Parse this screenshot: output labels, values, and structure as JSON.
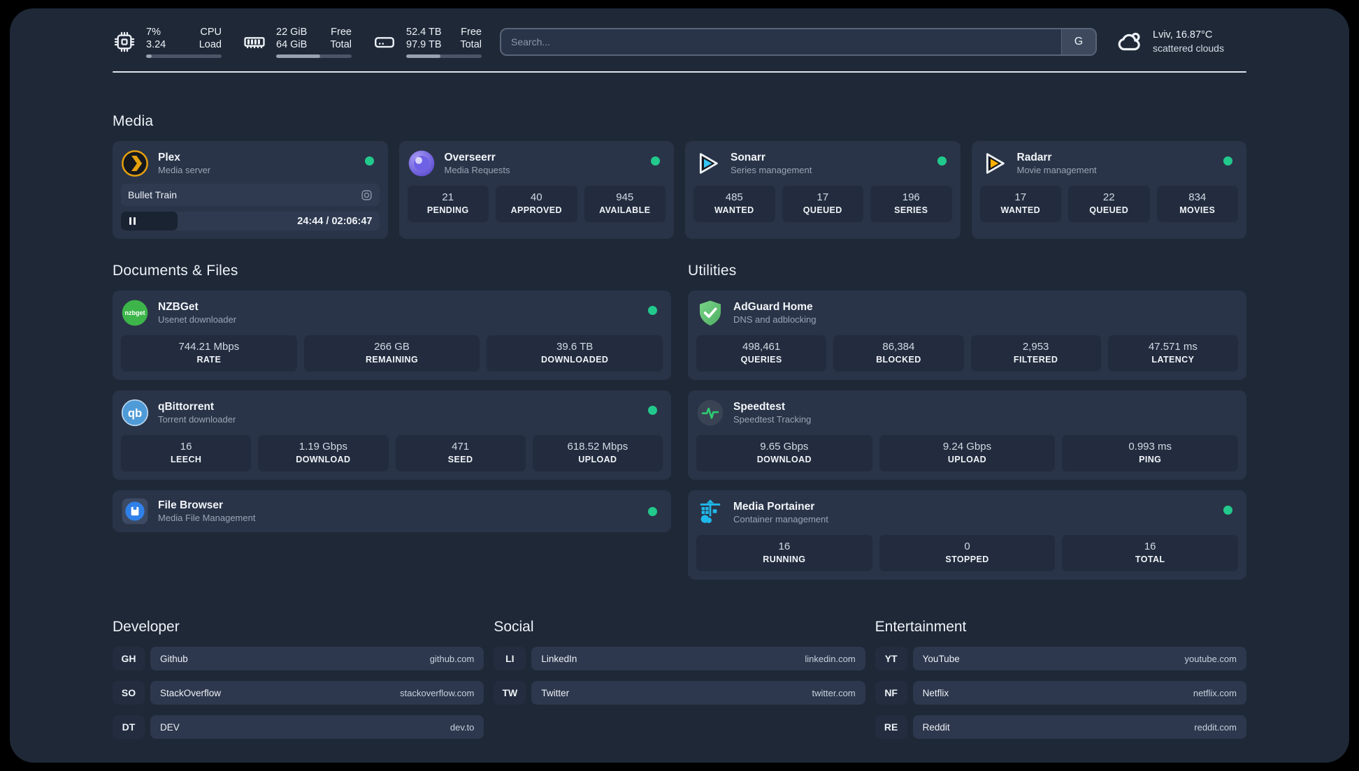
{
  "colors": {
    "status_online": "#22c98c",
    "page_bg": "#1e2837",
    "card_bg": "#2a3448",
    "plex_accent": "#e5a00d",
    "sonarr_accent": "#35c5f4",
    "radarr_accent": "#ffb000",
    "progress_fill": "#97a2b3"
  },
  "header": {
    "metrics": [
      {
        "name": "cpu",
        "values": [
          "7%",
          "3.24"
        ],
        "labels": [
          "CPU",
          "Load"
        ],
        "progress_pct": 7
      },
      {
        "name": "memory",
        "values": [
          "22 GiB",
          "64 GiB"
        ],
        "labels": [
          "Free",
          "Total"
        ],
        "progress_pct": 58
      },
      {
        "name": "disk",
        "values": [
          "52.4 TB",
          "97.9 TB"
        ],
        "labels": [
          "Free",
          "Total"
        ],
        "progress_pct": 45
      }
    ],
    "search": {
      "placeholder": "Search...",
      "button_label": "G"
    },
    "weather": {
      "location": "Lviv, 16.87°C",
      "condition": "scattered clouds"
    }
  },
  "media": {
    "title": "Media",
    "plex": {
      "name": "Plex",
      "description": "Media server",
      "online": true,
      "now_playing": "Bullet Train",
      "time_display": "24:44 / 02:06:47",
      "progress_pct": 22
    },
    "cards": [
      {
        "name": "Overseerr",
        "description": "Media Requests",
        "online": true,
        "stats": [
          {
            "value": "21",
            "label": "PENDING"
          },
          {
            "value": "40",
            "label": "APPROVED"
          },
          {
            "value": "945",
            "label": "AVAILABLE"
          }
        ]
      },
      {
        "name": "Sonarr",
        "description": "Series management",
        "online": true,
        "stats": [
          {
            "value": "485",
            "label": "WANTED"
          },
          {
            "value": "17",
            "label": "QUEUED"
          },
          {
            "value": "196",
            "label": "SERIES"
          }
        ]
      },
      {
        "name": "Radarr",
        "description": "Movie management",
        "online": true,
        "stats": [
          {
            "value": "17",
            "label": "WANTED"
          },
          {
            "value": "22",
            "label": "QUEUED"
          },
          {
            "value": "834",
            "label": "MOVIES"
          }
        ]
      }
    ]
  },
  "documents": {
    "title": "Documents & Files",
    "cards": [
      {
        "name": "NZBGet",
        "description": "Usenet downloader",
        "online": true,
        "logo_text": "nzbget",
        "stats": [
          {
            "value": "744.21 Mbps",
            "label": "RATE"
          },
          {
            "value": "266 GB",
            "label": "REMAINING"
          },
          {
            "value": "39.6 TB",
            "label": "DOWNLOADED"
          }
        ]
      },
      {
        "name": "qBittorrent",
        "description": "Torrent downloader",
        "online": true,
        "logo_text": "qb",
        "stats": [
          {
            "value": "16",
            "label": "LEECH"
          },
          {
            "value": "1.19 Gbps",
            "label": "DOWNLOAD"
          },
          {
            "value": "471",
            "label": "SEED"
          },
          {
            "value": "618.52 Mbps",
            "label": "UPLOAD"
          }
        ]
      },
      {
        "name": "File Browser",
        "description": "Media File Management",
        "online": true,
        "stats": []
      }
    ]
  },
  "utilities": {
    "title": "Utilities",
    "cards": [
      {
        "name": "AdGuard Home",
        "description": "DNS and adblocking",
        "online": false,
        "stats": [
          {
            "value": "498,461",
            "label": "QUERIES"
          },
          {
            "value": "86,384",
            "label": "BLOCKED"
          },
          {
            "value": "2,953",
            "label": "FILTERED"
          },
          {
            "value": "47.571 ms",
            "label": "LATENCY"
          }
        ]
      },
      {
        "name": "Speedtest",
        "description": "Speedtest Tracking",
        "online": false,
        "stats": [
          {
            "value": "9.65 Gbps",
            "label": "DOWNLOAD"
          },
          {
            "value": "9.24 Gbps",
            "label": "UPLOAD"
          },
          {
            "value": "0.993 ms",
            "label": "PING"
          }
        ]
      },
      {
        "name": "Media Portainer",
        "description": "Container management",
        "online": true,
        "stats": [
          {
            "value": "16",
            "label": "RUNNING"
          },
          {
            "value": "0",
            "label": "STOPPED"
          },
          {
            "value": "16",
            "label": "TOTAL"
          }
        ]
      }
    ]
  },
  "bookmarks": [
    {
      "title": "Developer",
      "links": [
        {
          "abbr": "GH",
          "name": "Github",
          "url": "github.com"
        },
        {
          "abbr": "SO",
          "name": "StackOverflow",
          "url": "stackoverflow.com"
        },
        {
          "abbr": "DT",
          "name": "DEV",
          "url": "dev.to"
        }
      ]
    },
    {
      "title": "Social",
      "links": [
        {
          "abbr": "LI",
          "name": "LinkedIn",
          "url": "linkedin.com"
        },
        {
          "abbr": "TW",
          "name": "Twitter",
          "url": "twitter.com"
        }
      ]
    },
    {
      "title": "Entertainment",
      "links": [
        {
          "abbr": "YT",
          "name": "YouTube",
          "url": "youtube.com"
        },
        {
          "abbr": "NF",
          "name": "Netflix",
          "url": "netflix.com"
        },
        {
          "abbr": "RE",
          "name": "Reddit",
          "url": "reddit.com"
        }
      ]
    }
  ]
}
